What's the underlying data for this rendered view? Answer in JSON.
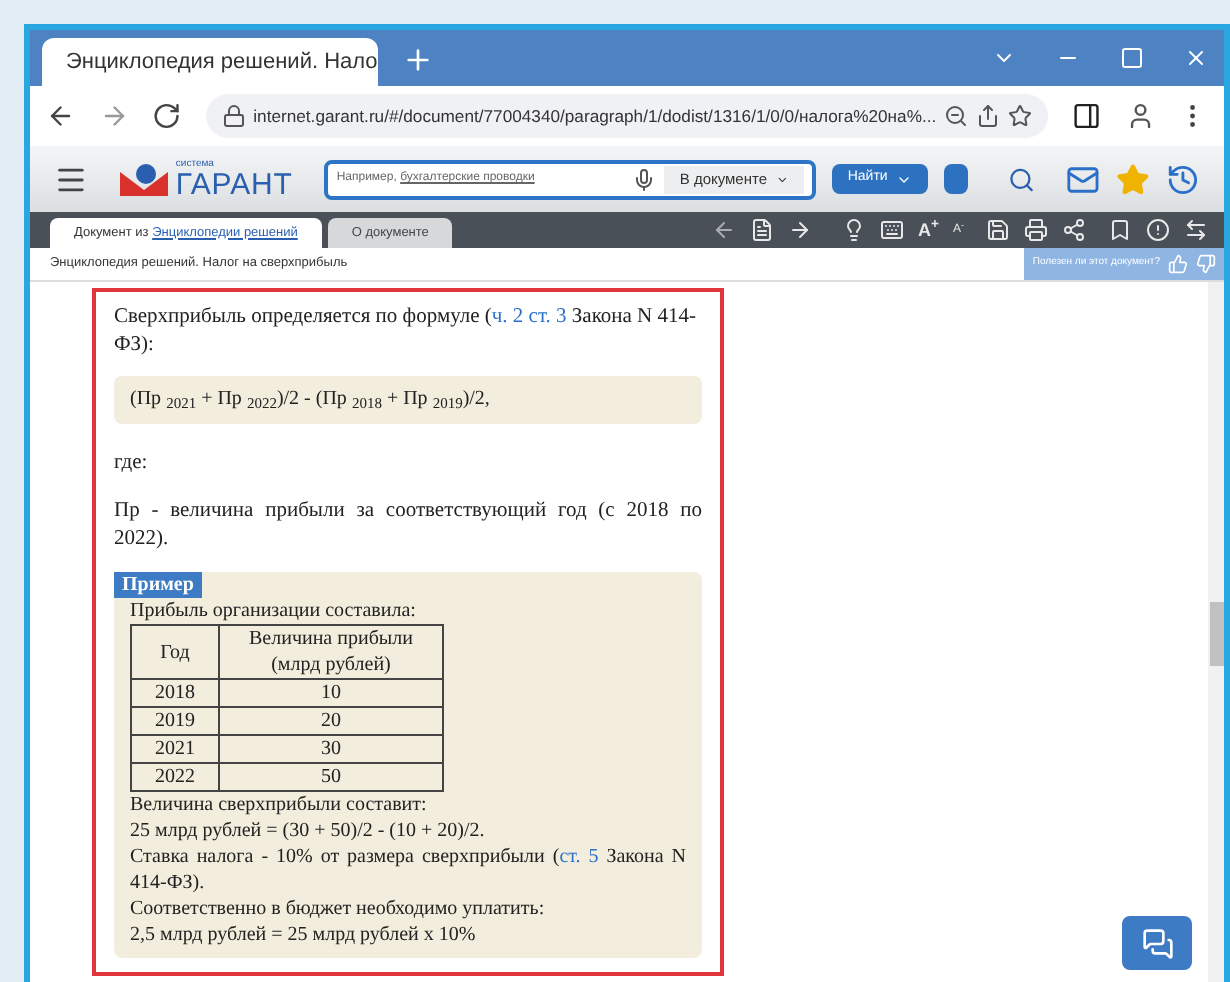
{
  "browser": {
    "tab_title": "Энциклопедия решений. Нало",
    "url": "internet.garant.ru/#/document/77004340/paragraph/1/dodist/1316/1/0/0/налога%20на%..."
  },
  "header": {
    "logo_small": "система",
    "logo": "ГАРАНТ",
    "search_hint": "Например,",
    "search_hint_link": "бухгалтерские проводки",
    "scope": "В документе",
    "find_button": "Найти"
  },
  "doc_tabs": [
    {
      "text": "Документ из",
      "link": "Энциклопедии решений",
      "selected": true
    },
    {
      "text": "О документе",
      "selected": false
    }
  ],
  "font_buttons": {
    "larger": "A$^{+}$",
    "smaller": "A$^{-}$"
  },
  "breadcrumb": "Энциклопедия решений. Налог на сверхприбыль",
  "feedback": "Полезен ли этот документ?",
  "content": {
    "intro": [
      {
        "text": "Сверхприбыль определяется по формуле ("
      },
      {
        "link": "ч. 2 ст. 3"
      },
      {
        "text": " Закона N 414-ФЗ):"
      }
    ],
    "formula": "(Пр $_{2021}$ + Пр $_{2022}$)/2 - (Пр $_{2018}$ + Пр $_{2019}$)/2,",
    "where": "где:",
    "definition": "Пр - величина прибыли за соответствующий год (с 2018 по 2022).",
    "example": {
      "label": "Пример",
      "intro": "Прибыль организации составила:",
      "columns": [
        "Год",
        "Величина прибыли (млрд рублей)"
      ],
      "rows": [
        [
          "2018",
          "10"
        ],
        [
          "2019",
          "20"
        ],
        [
          "2021",
          "30"
        ],
        [
          "2022",
          "50"
        ]
      ],
      "lines": [
        [
          {
            "text": "Величина сверхприбыли составит:"
          }
        ],
        [
          {
            "text": "25 млрд рублей = (30 + 50)/2 - (10 + 20)/2."
          }
        ],
        [
          {
            "text": "Ставка налога - 10% от размера сверхприбыли ("
          },
          {
            "link": "ст. 5"
          },
          {
            "text": " Закона N 414-ФЗ)."
          }
        ],
        [
          {
            "text": "Соответственно в бюджет необходимо уплатить:"
          }
        ],
        [
          {
            "text": "2,5 млрд рублей = 25 млрд рублей х 10%"
          }
        ]
      ]
    }
  }
}
